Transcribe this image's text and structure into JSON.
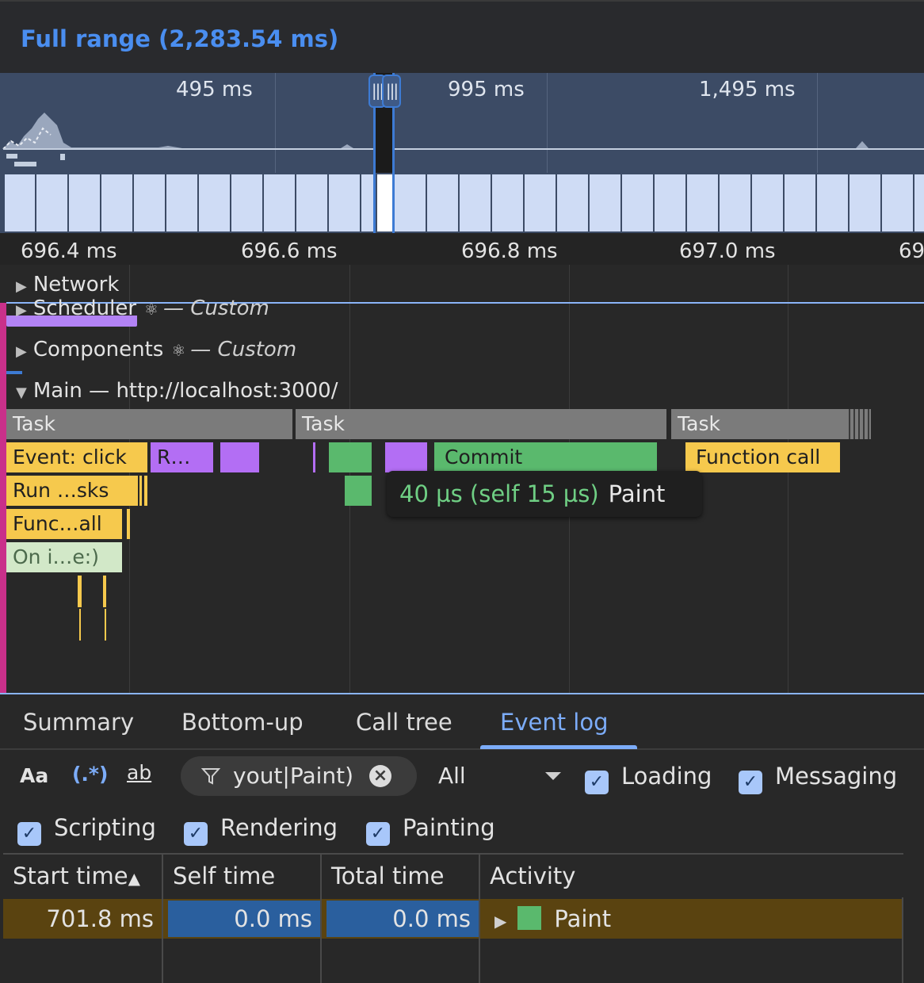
{
  "header": {
    "range_title": "Full range (2,283.54 ms)"
  },
  "overview": {
    "tick_labels": [
      "495 ms",
      "995 ms",
      "1,495 ms"
    ],
    "handle_left": "|||",
    "handle_right": "|||"
  },
  "ruler": {
    "labels": [
      "696.4 ms",
      "696.6 ms",
      "696.8 ms",
      "697.0 ms",
      "69"
    ]
  },
  "tracks": {
    "network": "Network",
    "scheduler": "Scheduler",
    "scheduler_suffix": "— Custom",
    "components": "Components",
    "components_suffix": "— Custom",
    "main": "Main — http://localhost:3000/"
  },
  "flame": {
    "task1": "Task",
    "task2": "Task",
    "task3": "Task",
    "event_click": "Event: click",
    "r_short": "R…",
    "commit": "Commit",
    "function_call": "Function call",
    "run_tasks": "Run …sks",
    "func_all": "Func…all",
    "on_i": "On i…e:)"
  },
  "tooltip": {
    "time": "40 µs (self 15 µs)",
    "name": "Paint"
  },
  "tabs": [
    "Summary",
    "Bottom-up",
    "Call tree",
    "Event log"
  ],
  "toolbar": {
    "match_case": "Aa",
    "regex": "(.*)",
    "whole_word": "ab",
    "filter_value": "yout|Paint)",
    "select_value": "All",
    "checkboxes": [
      "Loading",
      "Messaging",
      "Scripting",
      "Rendering",
      "Painting"
    ]
  },
  "table": {
    "headers": [
      "Start time",
      "Self time",
      "Total time",
      "Activity"
    ],
    "sort_indicator": "▲",
    "rows": [
      {
        "start": "701.8 ms",
        "self": "0.0 ms",
        "total": "0.0 ms",
        "activity": "Paint"
      }
    ]
  },
  "colors": {
    "accent": "#7cacf8",
    "paint_green": "#5ab96d",
    "scripting_yellow": "#f6c94d",
    "rendering_purple": "#b36ef4",
    "selected_row": "#5a4310"
  }
}
